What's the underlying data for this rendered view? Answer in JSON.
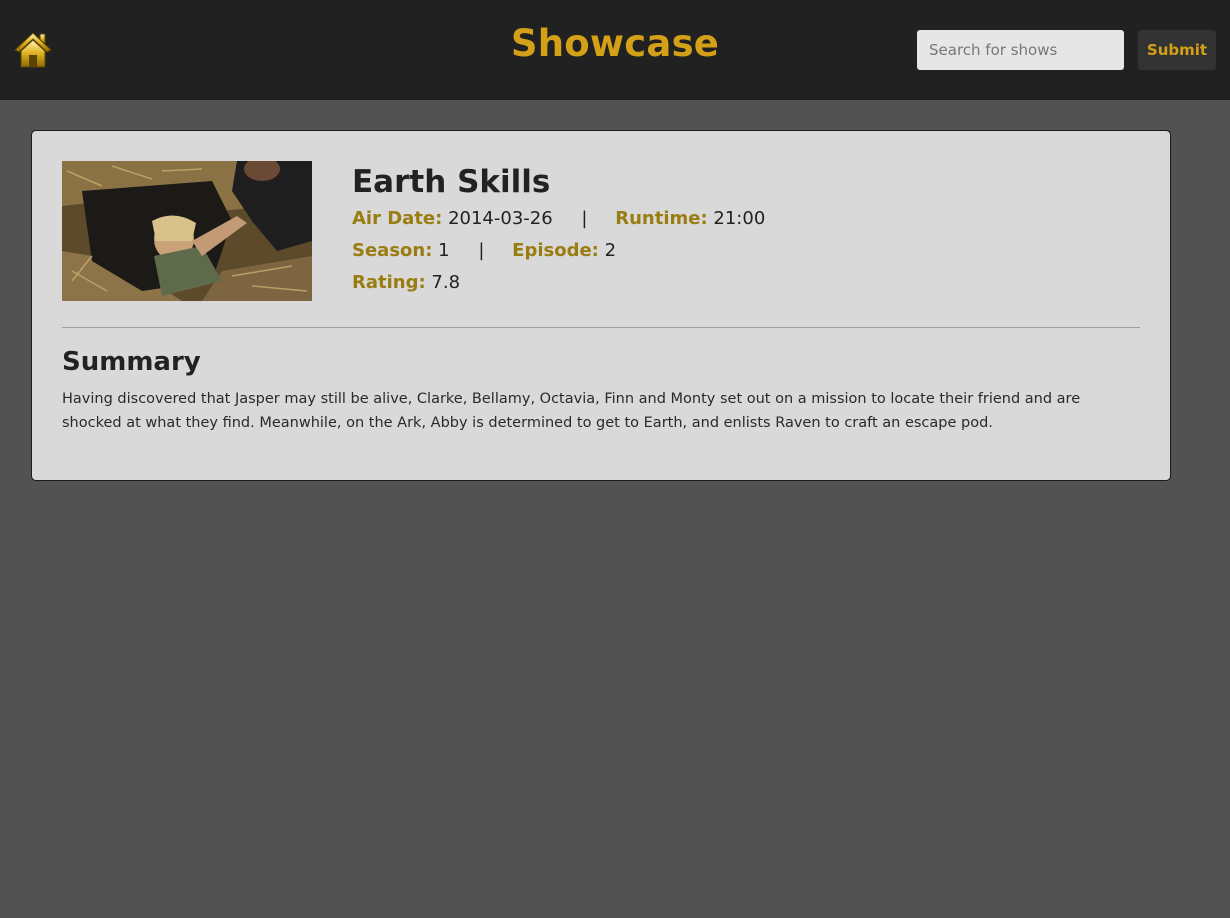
{
  "header": {
    "brand": "Showcase",
    "search_placeholder": "Search for shows",
    "submit_label": "Submit",
    "home_icon": "home-icon"
  },
  "episode": {
    "title": "Earth Skills",
    "air_date_label": "Air Date:",
    "air_date": "2014-03-26",
    "runtime_label": "Runtime:",
    "runtime": "21:00",
    "season_label": "Season:",
    "season": "1",
    "episode_label": "Episode:",
    "episode": "2",
    "rating_label": "Rating:",
    "rating": "7.8",
    "separator": "|"
  },
  "summary": {
    "heading": "Summary",
    "text": "Having discovered that Jasper may still be alive, Clarke, Bellamy, Octavia, Finn and Monty set out on a mission to locate their friend and are shocked at what they find. Meanwhile, on the Ark, Abby is determined to get to Earth, and enlists Raven to craft an escape pod."
  },
  "colors": {
    "accent": "#d4a017",
    "label": "#9a7d10",
    "navbar": "#212121",
    "page_bg": "#525252",
    "card_bg": "#d9d9d9"
  }
}
